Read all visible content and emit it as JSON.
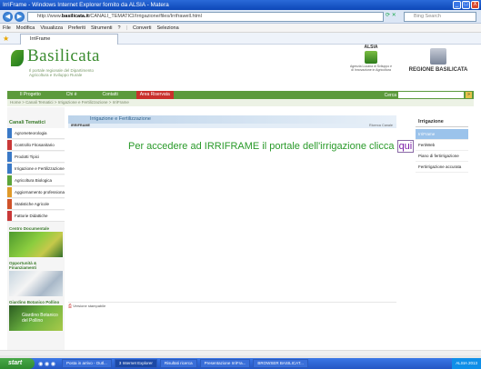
{
  "window": {
    "title": "IrriFrame - Windows Internet Explorer fornito da ALSIA - Matera",
    "buttons": [
      "_",
      "□",
      "X"
    ]
  },
  "address": {
    "url_prefix": "http://www.",
    "url_bold": "basilicata.it",
    "url_rest": "/CANALI_TEMATICI/Irrigazione/files/Irrifrawell.html",
    "search_placeholder": "Bing Search"
  },
  "menu": {
    "items": [
      "File",
      "Modifica",
      "Visualizza",
      "Preferiti",
      "Strumenti",
      "?"
    ],
    "convert": "Converti",
    "select": "Seleziona"
  },
  "favorites": {
    "tab_label": "IrriFrame"
  },
  "header": {
    "logo_name": "Basilicata",
    "logo_sub": "Il portale regionale del Dipartimento Agricoltura e Sviluppo Rurale",
    "alsia_name": "ALSIA",
    "alsia_sub": "Agenzia Lucana di Sviluppo e di Innovazione in Agricoltura",
    "region_name": "REGIONE BASILICATA"
  },
  "nav": {
    "items": [
      "Il Progetto",
      "Chi è",
      "Contatti"
    ],
    "reserved": "Area Riservata",
    "search_label": "Cerca"
  },
  "breadcrumb": "Home > Canali Tematici > Irrigazione e Fertilizzazione > IrriFrame",
  "left": {
    "title": "Canali Tematici",
    "items": [
      {
        "label": "Agrometeorologia",
        "color": "#3a79c7"
      },
      {
        "label": "Controllo Fitosanitario",
        "color": "#c93838"
      },
      {
        "label": "Prodotti Tipici",
        "color": "#3a79c7"
      },
      {
        "label": "Irrigazione e Fertilizzazione",
        "color": "#3a79c7"
      },
      {
        "label": "Agricoltura Biologica",
        "color": "#5da53a"
      },
      {
        "label": "Aggiornamento professionale",
        "color": "#e09a2a"
      },
      {
        "label": "Statistiche Agricole",
        "color": "#d0522a"
      },
      {
        "label": "Fattorie Didattiche",
        "color": "#c93838"
      }
    ],
    "promo1": "Centro Documentale",
    "promo2": "Opportunità & Finanziamenti",
    "promo3_title": "Giardino Botanico Pollino",
    "promo3_text": "Giardino Botanico del Pollino"
  },
  "main": {
    "band_title": "Irrigazione e Fertilizzazione",
    "sub_label": "IRRIFRAME",
    "sub_right": "Ricerca Canale",
    "headline": "Per accedere ad IRRIFRAME il portale dell'irrigazione clicca ",
    "link": "qui",
    "print": "Versione stampabile"
  },
  "right": {
    "title": "Irrigazione",
    "items": [
      "IrriFrame",
      "FertiWeb",
      "Piano di fertirrigazione",
      "Fertirrigazione accurata"
    ]
  },
  "taskbar": {
    "start": "start",
    "tasks": [
      "Posta in arrivo - Outl...",
      "3 Internet Explorer",
      "Risultati ricerca",
      "Presentazione IrriFra...",
      "BROWSER BASILICAT..."
    ],
    "tray": "ALSIA 2013"
  }
}
